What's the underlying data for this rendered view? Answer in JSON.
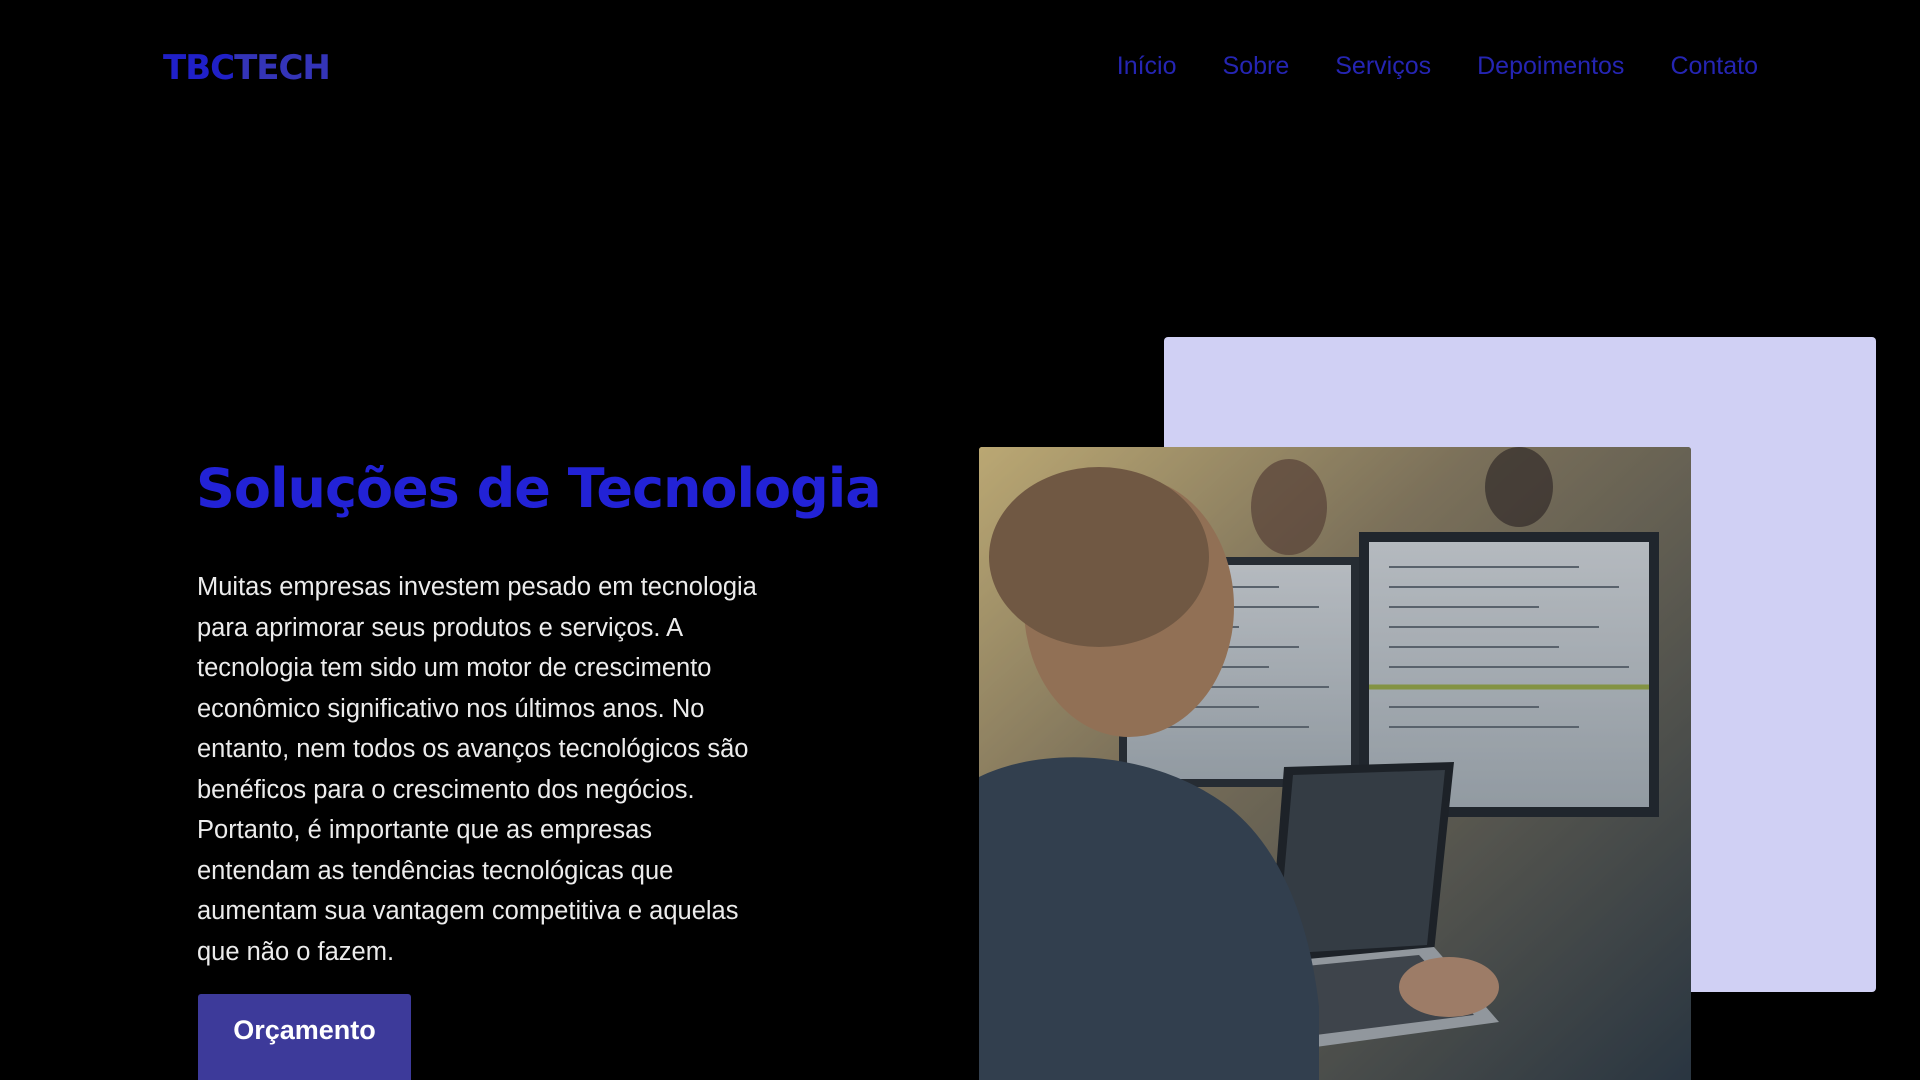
{
  "header": {
    "logo_part1": "TBC",
    "logo_part2": "TECH",
    "nav": [
      "Início",
      "Sobre",
      "Serviços",
      "Depoimentos",
      "Contato"
    ]
  },
  "hero": {
    "title": "Soluções de Tecnologia",
    "paragraph": "Muitas empresas investem pesado em tecnologia para aprimorar seus produtos e serviços. A tecnologia tem sido um motor de crescimento econômico significativo nos últimos anos. No entanto, nem todos os avanços tecnológicos são benéficos para o crescimento dos negócios. Portanto, é importante que as empresas entendam as tendências tecnológicas que aumentam sua vantagem competitiva e aquelas que não o fazem.",
    "button_label": "Orçamento"
  },
  "colors": {
    "background": "#000000",
    "accent": "#2222d6",
    "button": "#3d3a9a",
    "backdrop": "#d0d0f4"
  }
}
